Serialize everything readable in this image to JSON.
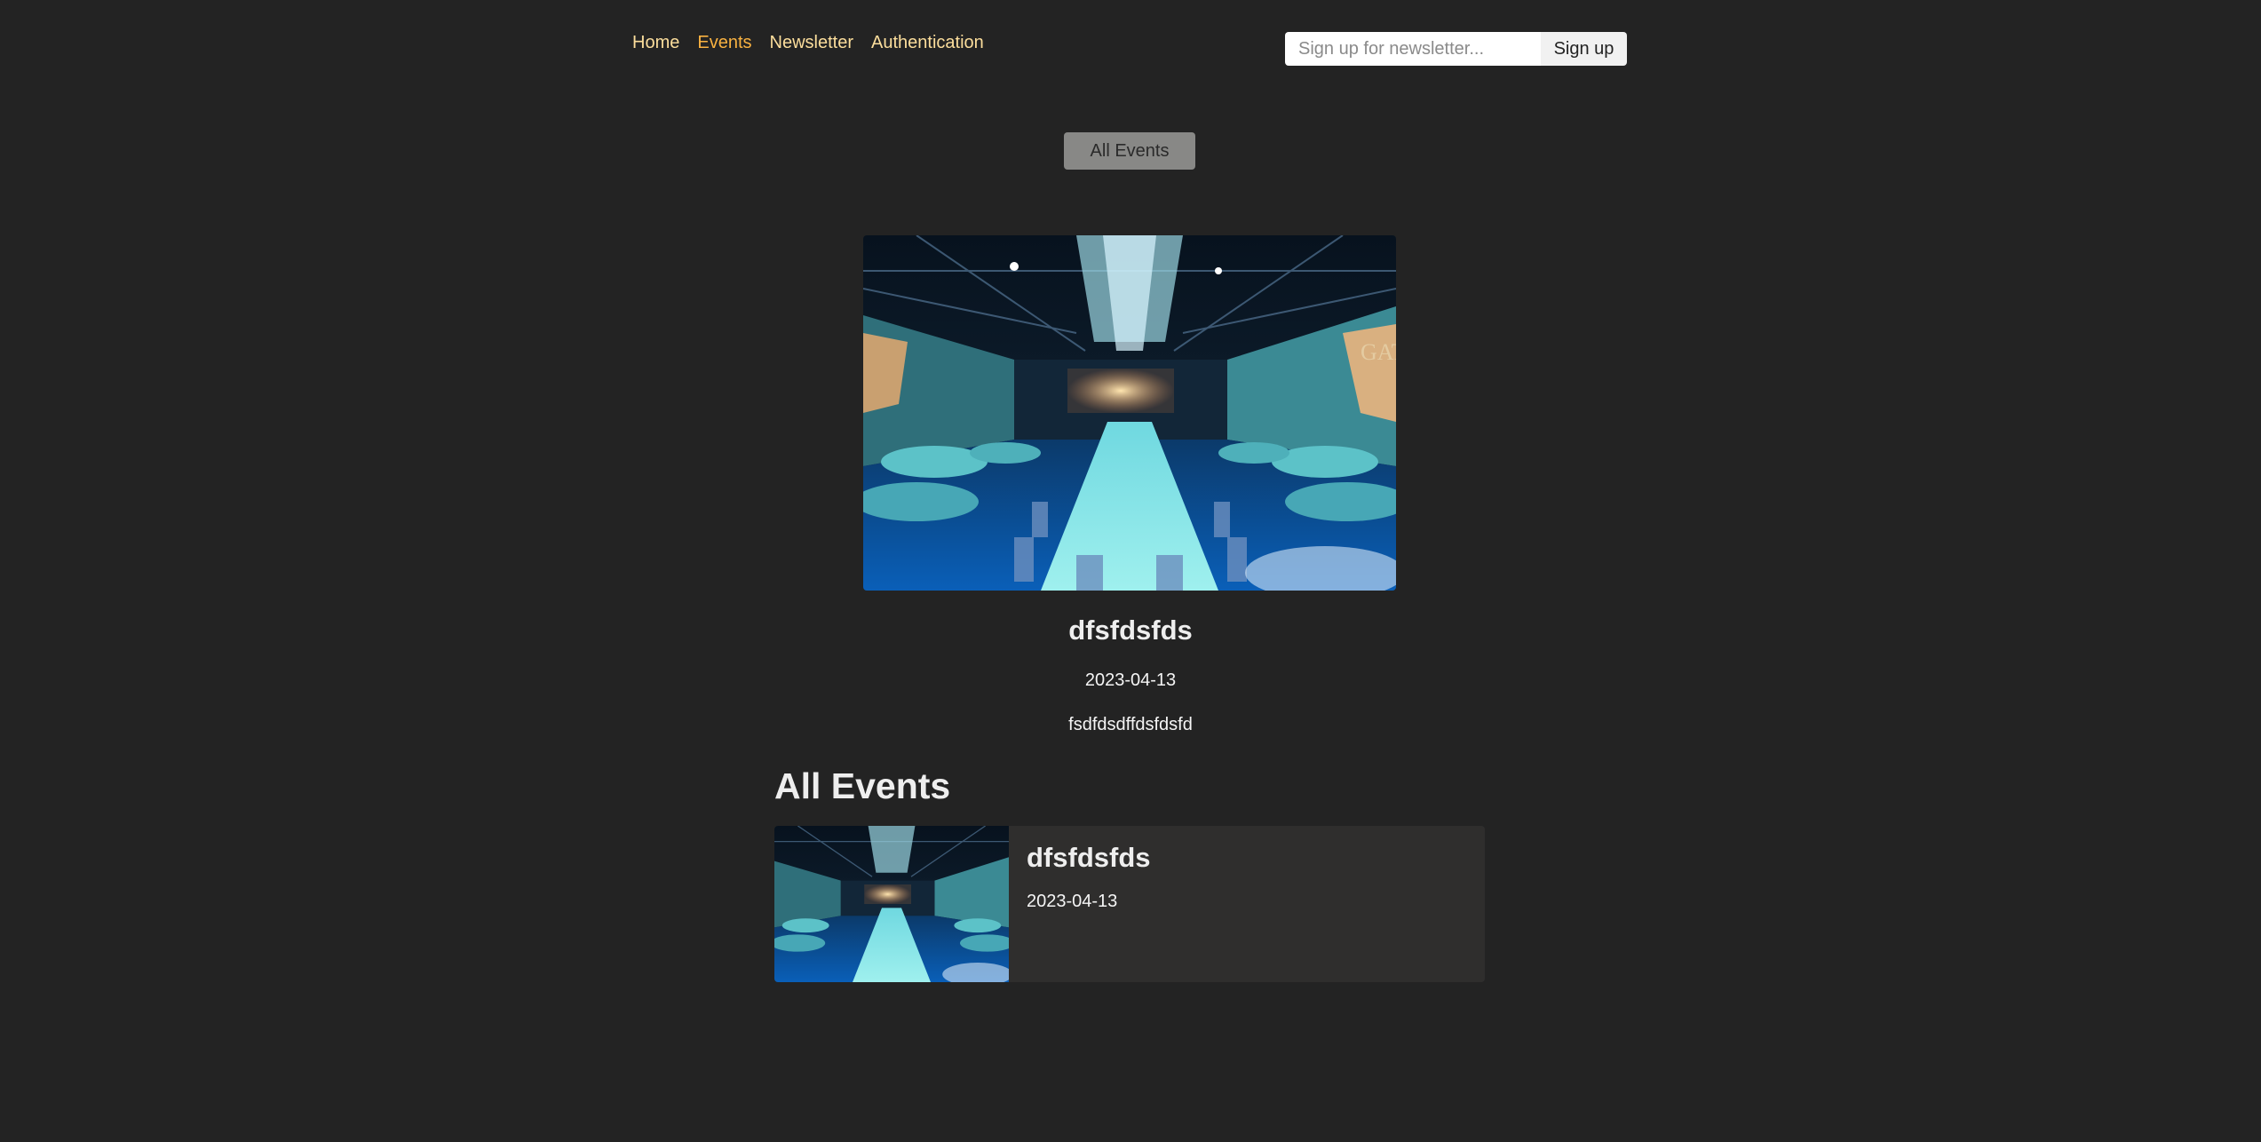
{
  "nav": {
    "items": [
      {
        "label": "Home",
        "active": false
      },
      {
        "label": "Events",
        "active": true
      },
      {
        "label": "Newsletter",
        "active": false
      },
      {
        "label": "Authentication",
        "active": false
      }
    ]
  },
  "newsletter": {
    "placeholder": "Sign up for newsletter...",
    "value": "",
    "button_label": "Sign up"
  },
  "events_nav": {
    "all_events_label": "All Events"
  },
  "featured_event": {
    "image_icon": "event-hall-photo",
    "title": "dfsfdsfds",
    "date": "2023-04-13",
    "description": "fsdfdsdffdsfdsfd"
  },
  "events_list": {
    "heading": "All Events",
    "items": [
      {
        "title": "dfsfdsfds",
        "date": "2023-04-13",
        "image_icon": "event-hall-thumbnail"
      }
    ]
  },
  "colors": {
    "background": "#232323",
    "nav_link": "#fcde9c",
    "nav_active": "#f9b241",
    "card_background": "#2f2e2d",
    "button_gray": "#888886"
  }
}
